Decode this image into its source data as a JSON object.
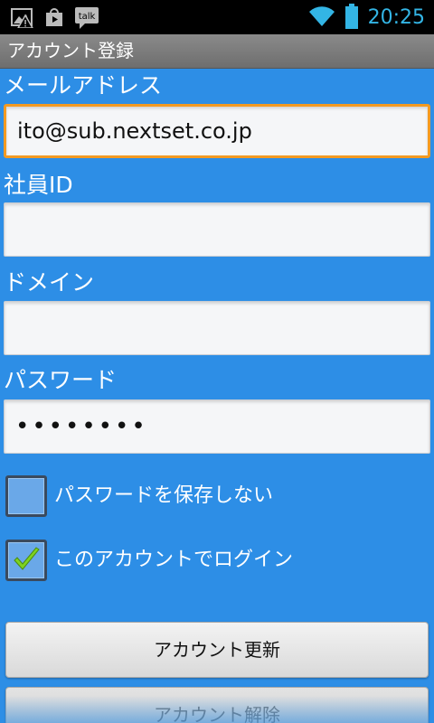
{
  "status_bar": {
    "time": "20:25",
    "talk_label": "talk",
    "icons": [
      "image-warning-icon",
      "play-store-icon",
      "talk-icon",
      "wifi-icon",
      "battery-icon"
    ]
  },
  "title_bar": {
    "title": "アカウント登録"
  },
  "form": {
    "email": {
      "label": "メールアドレス",
      "value": "ito@sub.nextset.co.jp"
    },
    "employee_id": {
      "label": "社員ID",
      "value": ""
    },
    "domain": {
      "label": "ドメイン",
      "value": ""
    },
    "password": {
      "label": "パスワード",
      "value": "••••••••"
    },
    "dont_save_password": {
      "label": "パスワードを保存しない",
      "checked": false
    },
    "login_with_account": {
      "label": "このアカウントでログイン",
      "checked": true
    }
  },
  "buttons": {
    "update": "アカウント更新",
    "remove": "アカウント解除"
  },
  "colors": {
    "background": "#2d8ee6",
    "focus_border": "#f39a22",
    "status_time": "#33b5e5",
    "checkmark": "#7ed321"
  }
}
